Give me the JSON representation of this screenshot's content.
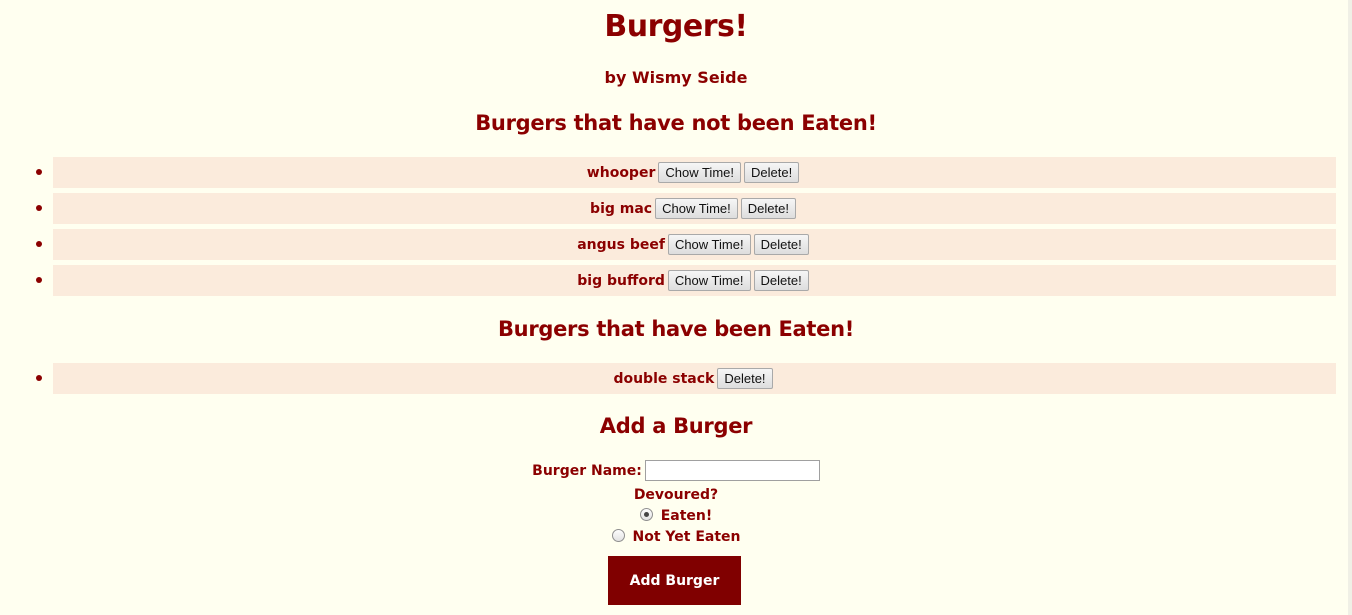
{
  "header": {
    "title": "Burgers!",
    "subtitle": "by Wismy Seide"
  },
  "not_eaten": {
    "heading": "Burgers that have not been Eaten!",
    "items": [
      {
        "name": "whooper",
        "eat_label": "Chow Time!",
        "delete_label": "Delete!"
      },
      {
        "name": "big mac",
        "eat_label": "Chow Time!",
        "delete_label": "Delete!"
      },
      {
        "name": "angus beef",
        "eat_label": "Chow Time!",
        "delete_label": "Delete!"
      },
      {
        "name": "big bufford",
        "eat_label": "Chow Time!",
        "delete_label": "Delete!"
      }
    ]
  },
  "eaten": {
    "heading": "Burgers that have been Eaten!",
    "items": [
      {
        "name": "double stack",
        "delete_label": "Delete!"
      }
    ]
  },
  "add_form": {
    "heading": "Add a Burger",
    "name_label": "Burger Name:",
    "name_value": "",
    "devoured_label": "Devoured?",
    "option_eaten": "Eaten!",
    "option_not_eaten": "Not Yet Eaten",
    "selected_option": "Eaten!",
    "submit_label": "Add Burger"
  },
  "colors": {
    "background": "#fffff0",
    "text": "#8b0000",
    "row_band": "#fbebdc",
    "submit_button": "#800000"
  }
}
